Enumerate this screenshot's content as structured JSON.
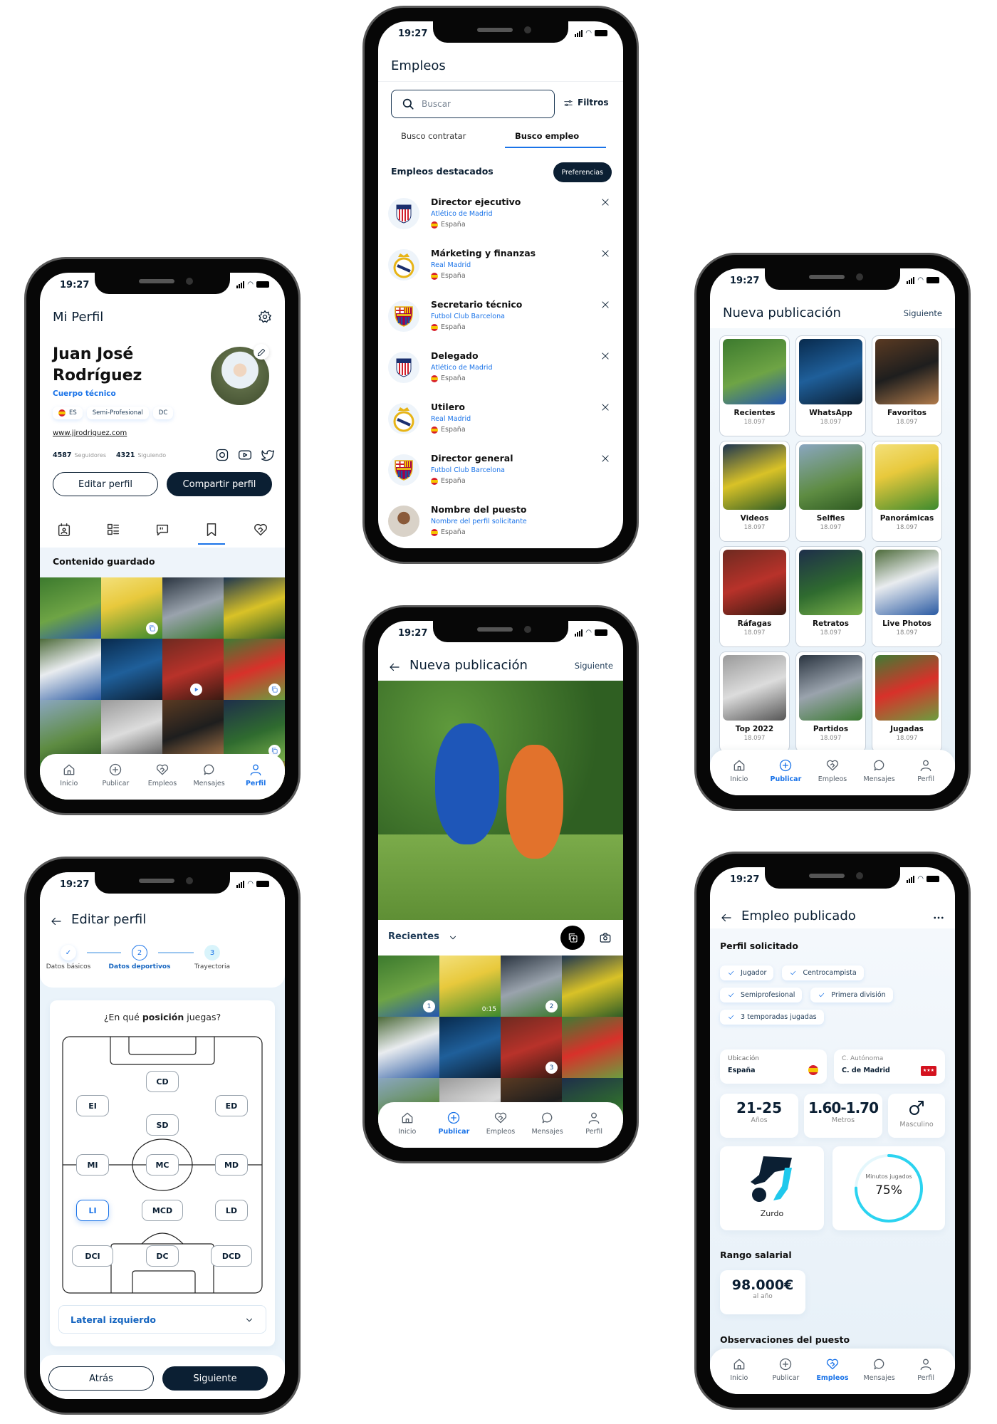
{
  "status": {
    "time": "19:27"
  },
  "nav": {
    "items": [
      {
        "label": "Inicio",
        "icon": "home"
      },
      {
        "label": "Publicar",
        "icon": "plus-circle"
      },
      {
        "label": "Empleos",
        "icon": "handshake"
      },
      {
        "label": "Mensajes",
        "icon": "chat"
      },
      {
        "label": "Perfil",
        "icon": "user"
      }
    ]
  },
  "colors": {
    "navy": "#0b1f33",
    "accent": "#1a73e8",
    "light_bg": "#eef4fa",
    "cyan": "#2bd3f0"
  },
  "profile": {
    "title": "Mi Perfil",
    "name_line1": "Juan José",
    "name_line2": "Rodríguez",
    "role": "Cuerpo técnico",
    "tags": [
      "ES",
      "Semi-Profesional",
      "DC"
    ],
    "website": "www.jjrodriguez.com",
    "followers_count": "4587",
    "followers_label": "Seguidores",
    "following_count": "4321",
    "following_label": "Siguiendo",
    "edit_button": "Editar perfil",
    "share_button": "Compartir perfil",
    "tabs": [
      "calendar-user",
      "grid-list",
      "quote",
      "bookmark",
      "handshake"
    ],
    "active_tab": "bookmark",
    "section_title": "Contenido guardado",
    "saved": [
      "",
      "multi",
      "",
      "",
      "",
      "",
      "video",
      "multi",
      "",
      "",
      "",
      "multi",
      "",
      "video",
      "",
      ""
    ],
    "nav_active": "Perfil"
  },
  "jobs": {
    "title": "Empleos",
    "search_placeholder": "Buscar",
    "filters_label": "Filtros",
    "tabs": [
      "Busco contratar",
      "Busco empleo"
    ],
    "active_tab": "Busco empleo",
    "section_title": "Empleos destacados",
    "preferences_button": "Preferencias",
    "items": [
      {
        "title": "Director ejecutivo",
        "club": "Atlético de Madrid",
        "country": "España",
        "logo": "atletico"
      },
      {
        "title": "Márketing y finanzas",
        "club": "Real Madrid",
        "country": "España",
        "logo": "realmadrid"
      },
      {
        "title": "Secretario técnico",
        "club": "Futbol Club Barcelona",
        "country": "España",
        "logo": "barcelona"
      },
      {
        "title": "Delegado",
        "club": "Atlético de Madrid",
        "country": "España",
        "logo": "atletico"
      },
      {
        "title": "Utilero",
        "club": "Real Madrid",
        "country": "España",
        "logo": "realmadrid"
      },
      {
        "title": "Director general",
        "club": "Futbol Club Barcelona",
        "country": "España",
        "logo": "barcelona"
      },
      {
        "title": "Nombre del puesto",
        "club": "Nombre del perfil solicitante",
        "country": "España",
        "logo": "avatar"
      }
    ]
  },
  "albums": {
    "title": "Nueva publicación",
    "next": "Siguiente",
    "items": [
      {
        "name": "Recientes",
        "count": "18.097"
      },
      {
        "name": "WhatsApp",
        "count": "18.097"
      },
      {
        "name": "Favoritos",
        "count": "18.097"
      },
      {
        "name": "Videos",
        "count": "18.097"
      },
      {
        "name": "Selfies",
        "count": "18.097"
      },
      {
        "name": "Panorámicas",
        "count": "18.097"
      },
      {
        "name": "Ráfagas",
        "count": "18.097"
      },
      {
        "name": "Retratos",
        "count": "18.097"
      },
      {
        "name": "Live Photos",
        "count": "18.097"
      },
      {
        "name": "Top 2022",
        "count": "18.097"
      },
      {
        "name": "Partidos",
        "count": "18.097"
      },
      {
        "name": "Jugadas",
        "count": "18.097"
      }
    ],
    "nav_active": "Publicar"
  },
  "new_post": {
    "title": "Nueva publicación",
    "next": "Siguiente",
    "album": "Recientes",
    "gallery": [
      "1",
      "0:15",
      "2",
      "",
      "",
      "",
      "3",
      "",
      "",
      "",
      "",
      ""
    ],
    "nav_active": "Publicar"
  },
  "edit_profile": {
    "title": "Editar perfil",
    "steps": [
      {
        "num": "✓",
        "label": "Datos básicos",
        "state": "done"
      },
      {
        "num": "2",
        "label": "Datos deportivos",
        "state": "current"
      },
      {
        "num": "3",
        "label": "Trayectoria",
        "state": "todo"
      }
    ],
    "question_pre": "¿En qué ",
    "question_bold": "posición",
    "question_post": " juegas?",
    "positions": [
      "CD",
      "EI",
      "ED",
      "SD",
      "MI",
      "MC",
      "MD",
      "LI",
      "MCD",
      "LD",
      "DCI",
      "DC",
      "DCD"
    ],
    "selected_position": "LI",
    "select_value": "Lateral izquierdo",
    "back_button": "Atrás",
    "next_button": "Siguiente"
  },
  "job_posted": {
    "title": "Empleo publicado",
    "section_profile": "Perfil solicitado",
    "requirements": [
      "Jugador",
      "Centrocampista",
      "Semiprofesional",
      "Primera división",
      "3 temporadas jugadas"
    ],
    "location_label": "Ubicación",
    "location_value": "España",
    "region_label": "C. Autónoma",
    "region_value": "C. de Madrid",
    "age_value": "21-25",
    "age_label": "Años",
    "height_value": "1.60-1.70",
    "height_label": "Metros",
    "gender_label": "Masculino",
    "foot_label": "Zurdo",
    "minutes_label": "Minutos jugados",
    "minutes_value": "75%",
    "minutes_percent": 75,
    "salary_title": "Rango salarial",
    "salary_value": "98.000€",
    "salary_period": "al año",
    "observations_title": "Observaciones del puesto",
    "nav_active": "Empleos"
  }
}
